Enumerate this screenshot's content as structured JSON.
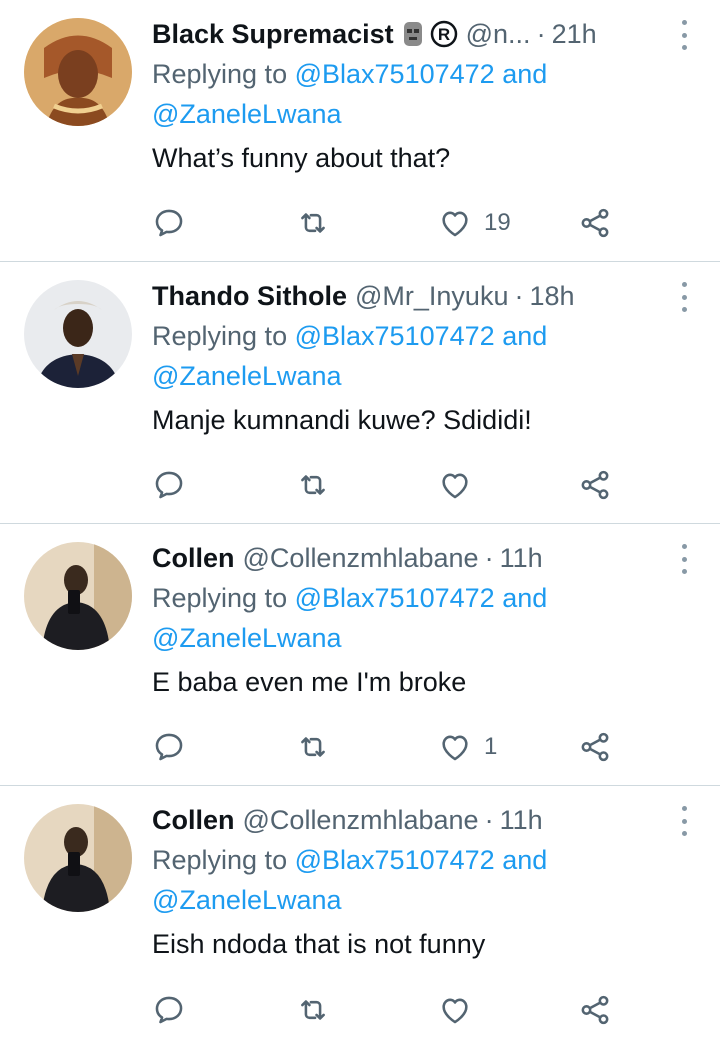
{
  "tweets": [
    {
      "name": "Black Supremacist",
      "handle": "@n...",
      "time": "21h",
      "reply_prefix": "Replying to",
      "mention1": "@Blax75107472",
      "and": "and",
      "mention2": "@ZaneleLwana",
      "text": "What’s funny about that?",
      "likes": "19",
      "badges": [
        "moai-emoji-icon",
        "registered-icon"
      ]
    },
    {
      "name": "Thando Sithole",
      "handle": "@Mr_Inyuku",
      "time": "18h",
      "reply_prefix": "Replying to",
      "mention1": "@Blax75107472",
      "and": "and",
      "mention2": "@ZaneleLwana",
      "text": "Manje kumnandi kuwe? Sdididi!",
      "likes": ""
    },
    {
      "name": "Collen",
      "handle": "@Collenzmhlabane",
      "time": "11h",
      "reply_prefix": "Replying to",
      "mention1": "@Blax75107472",
      "and": "and",
      "mention2": "@ZaneleLwana",
      "text": "E baba even me I'm broke",
      "likes": "1"
    },
    {
      "name": "Collen",
      "handle": "@Collenzmhlabane",
      "time": "11h",
      "reply_prefix": "Replying to",
      "mention1": "@Blax75107472",
      "and": "and",
      "mention2": "@ZaneleLwana",
      "text": "Eish ndoda that is not funny",
      "likes": ""
    }
  ],
  "colors": {
    "link": "#1d9bf0",
    "secondary": "#536471",
    "divider": "#cfd9de",
    "icon": "#536471"
  },
  "icons": [
    "reply-icon",
    "retweet-icon",
    "like-icon",
    "share-icon",
    "more-options-icon"
  ]
}
